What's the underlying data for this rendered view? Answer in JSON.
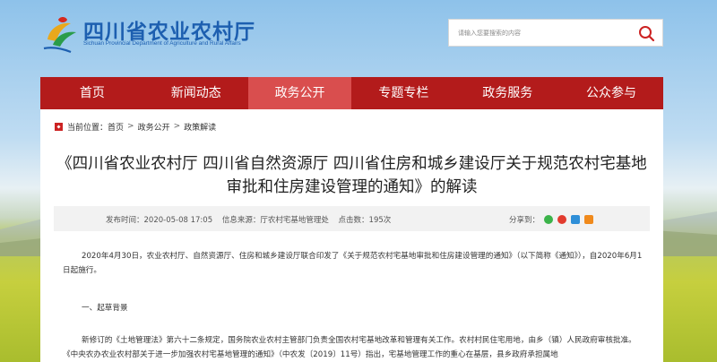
{
  "header": {
    "logo_cn": "四川省农业农村厅",
    "logo_en": "Sichuan Provincial Department of Agriculture and Rural Affairs"
  },
  "search": {
    "placeholder": "请输入您要搜索的内容",
    "icon": "search-icon"
  },
  "nav": {
    "items": [
      {
        "label": "首页"
      },
      {
        "label": "新闻动态"
      },
      {
        "label": "政务公开"
      },
      {
        "label": "专题专栏"
      },
      {
        "label": "政务服务"
      },
      {
        "label": "公众参与"
      }
    ],
    "active_index": 2
  },
  "breadcrumb": {
    "prefix": "当前位置：",
    "items": [
      "首页",
      "政务公开",
      "政策解读"
    ],
    "separator": ">"
  },
  "article": {
    "title": "《四川省农业农村厅 四川省自然资源厅 四川省住房和城乡建设厅关于规范农村宅基地审批和住房建设管理的通知》的解读",
    "publish_time": "发布时间：2020-05-08 17:05",
    "source": "信息来源：厅农村宅基地管理处",
    "clicks": "点击数：195次",
    "share_label": "分享到：",
    "paragraphs": [
      "2020年4月30日，农业农村厅、自然资源厅、住房和城乡建设厅联合印发了《关于规范农村宅基地审批和住房建设管理的通知》（以下简称《通知》），自2020年6月1日起施行。",
      "一、起草背景",
      "新修订的《土地管理法》第六十二条规定，国务院农业农村主管部门负责全国农村宅基地改革和管理有关工作。农村村民住宅用地，由乡（镇）人民政府审核批准。《中央农办农业农村部关于进一步加强农村宅基地管理的通知》（中农发〔2019〕11号）指出，宅基地管理工作的重心在基层，县乡政府承担属地"
    ]
  },
  "colors": {
    "nav_bg": "#b31b1b",
    "nav_active": "#d94e4e",
    "logo_blue": "#1d5fb0"
  }
}
